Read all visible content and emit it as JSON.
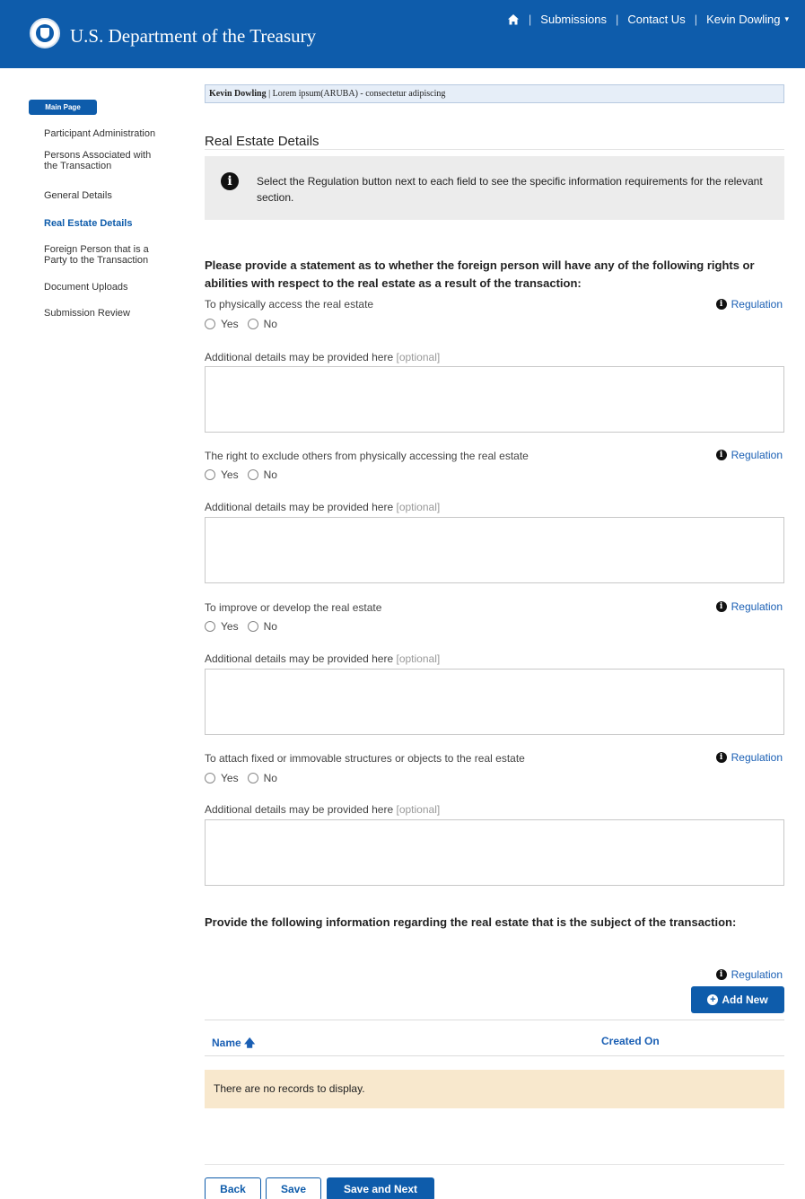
{
  "header": {
    "brand": "U.S. Department of the Treasury",
    "nav": [
      "Submissions",
      "Contact Us"
    ],
    "user": "Kevin Dowling",
    "home_icon": "home-icon",
    "brand_color": "#0e5cab"
  },
  "sidebar": {
    "main_page": "Main Page",
    "items": [
      {
        "label": "Participant Administration"
      },
      {
        "label": "Persons Associated with the Transaction"
      },
      {
        "label": "General Details"
      },
      {
        "label": "Real Estate Details",
        "active": true
      },
      {
        "label": "Foreign Person that is a Party to the Transaction"
      },
      {
        "label": "Document Uploads"
      },
      {
        "label": "Submission Review"
      }
    ]
  },
  "breadcrumb": {
    "user": "Kevin Dowling",
    "text": " | Lorem ipsum(ARUBA) - consectetur adipiscing"
  },
  "page": {
    "title": "Real Estate Details",
    "info": "Select the Regulation button next to each field to see the specific information requirements for the relevant section.",
    "statement_heading": "Please provide a statement as to whether the foreign person will have any of the following rights or abilities with respect to the real estate as a result of the transaction:",
    "regulation_label": "Regulation",
    "yes_label": "Yes",
    "no_label": "No",
    "additional_label": "Additional details may be provided here",
    "optional_label": "[optional]",
    "questions": [
      {
        "label": "To physically access the real estate",
        "value": ""
      },
      {
        "label": "The right to exclude others from physically accessing the real estate",
        "value": ""
      },
      {
        "label": "To improve or develop the real estate",
        "value": ""
      },
      {
        "label": "To attach fixed or immovable structures or objects to the real estate",
        "value": ""
      }
    ],
    "info_heading": "Provide the following information regarding the real estate that is the subject of the transaction:",
    "add_new": "Add New",
    "table": {
      "columns": [
        "Name",
        "Created On"
      ],
      "sort_icon": "arrow-up-icon",
      "empty": "There are no records to display."
    },
    "buttons": {
      "back": "Back",
      "save": "Save",
      "save_next": "Save and Next"
    }
  }
}
